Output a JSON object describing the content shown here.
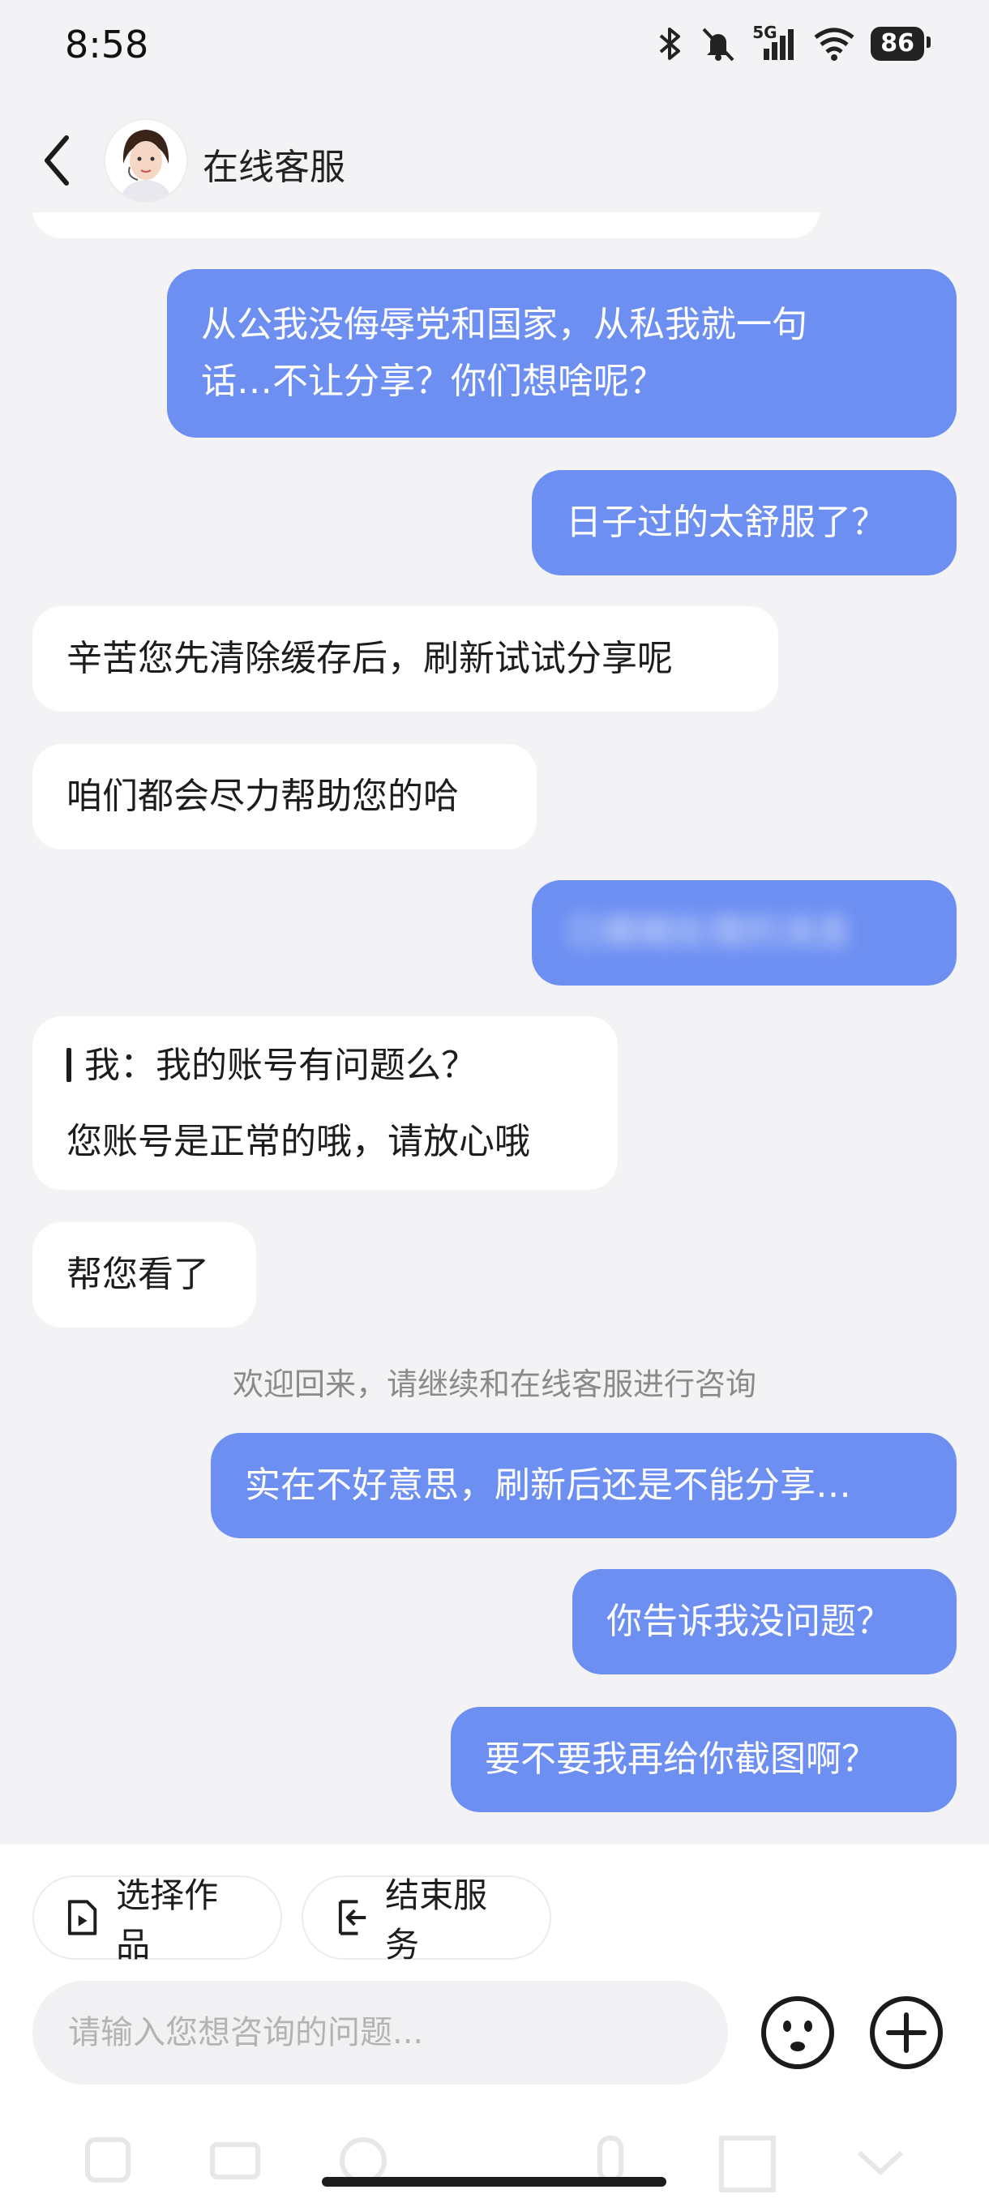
{
  "status_bar": {
    "time": "8:58",
    "network": "5G",
    "battery": "86",
    "icons": [
      "bluetooth-icon",
      "mute-icon",
      "signal-icon",
      "wifi-icon",
      "battery-icon"
    ]
  },
  "header": {
    "title": "在线客服",
    "back_icon": "chevron-left-icon",
    "avatar": "agent-avatar"
  },
  "messages": [
    {
      "sender": "me",
      "text": "从公我没侮辱党和国家，从私我就一句"
    },
    {
      "sender": "me",
      "text": "话…不让分享？你们想啥呢？"
    },
    {
      "sender": "me",
      "text": "日子过的太舒服了？"
    },
    {
      "sender": "cs",
      "text": "辛苦您先清除缓存后，刷新试试分享呢"
    },
    {
      "sender": "cs",
      "text": "咱们都会尽力帮助您的哈"
    },
    {
      "sender": "me",
      "text": "已模糊处理的消息",
      "blurred": true
    },
    {
      "sender": "cs",
      "quote": "我：我的账号有问题么？",
      "text": "您账号是正常的哦，请放心哦"
    },
    {
      "sender": "cs",
      "text": "帮您看了"
    },
    {
      "sender": "system",
      "text": "欢迎回来，请继续和在线客服进行咨询"
    },
    {
      "sender": "me",
      "text": "实在不好意思，刷新后还是不能分享…"
    },
    {
      "sender": "me",
      "text": "你告诉我没问题？"
    },
    {
      "sender": "me",
      "text": "要不要我再给你截图啊？"
    }
  ],
  "actions": {
    "select_work": "选择作品",
    "end_service": "结束服务"
  },
  "input": {
    "placeholder": "请输入您想咨询的问题...",
    "value": ""
  },
  "colors": {
    "my_bubble": "#6d8ff2",
    "cs_bubble": "#ffffff",
    "background": "#f3f3f5"
  }
}
